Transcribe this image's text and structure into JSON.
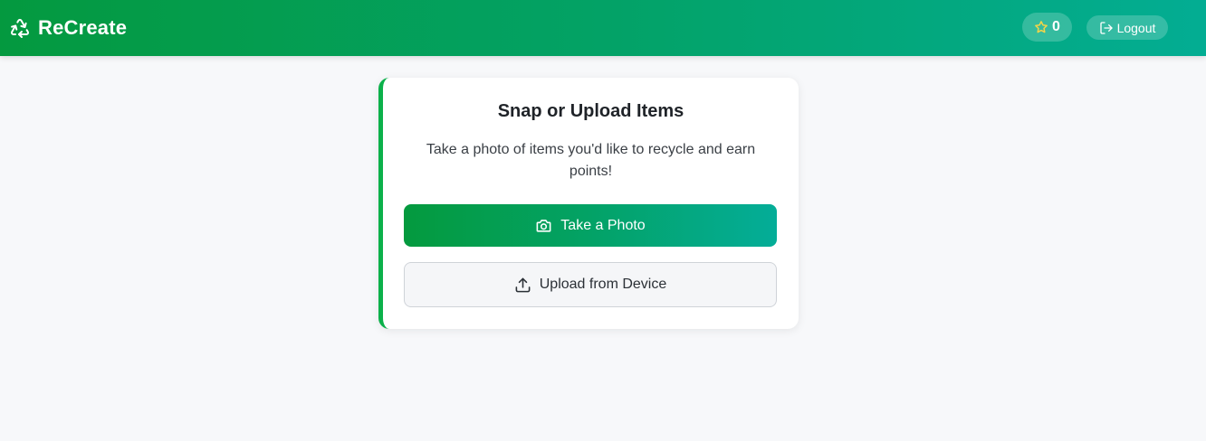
{
  "header": {
    "brand_icon": "recycle-icon",
    "brand_title": "ReCreate",
    "points_icon": "star-icon",
    "points_value": "0",
    "logout_icon": "logout-icon",
    "logout_label": "Logout"
  },
  "card": {
    "title": "Snap or Upload Items",
    "description": "Take a photo of items you'd like to recycle and earn points!",
    "primary_button": {
      "icon": "camera-icon",
      "label": "Take a Photo"
    },
    "secondary_button": {
      "icon": "upload-icon",
      "label": "Upload from Device"
    }
  },
  "colors": {
    "brand_gradient_start": "#04993f",
    "brand_gradient_end": "#03ad93",
    "card_accent": "#0bb14a",
    "star": "#f5d547",
    "page_background": "#f7f8fa"
  }
}
